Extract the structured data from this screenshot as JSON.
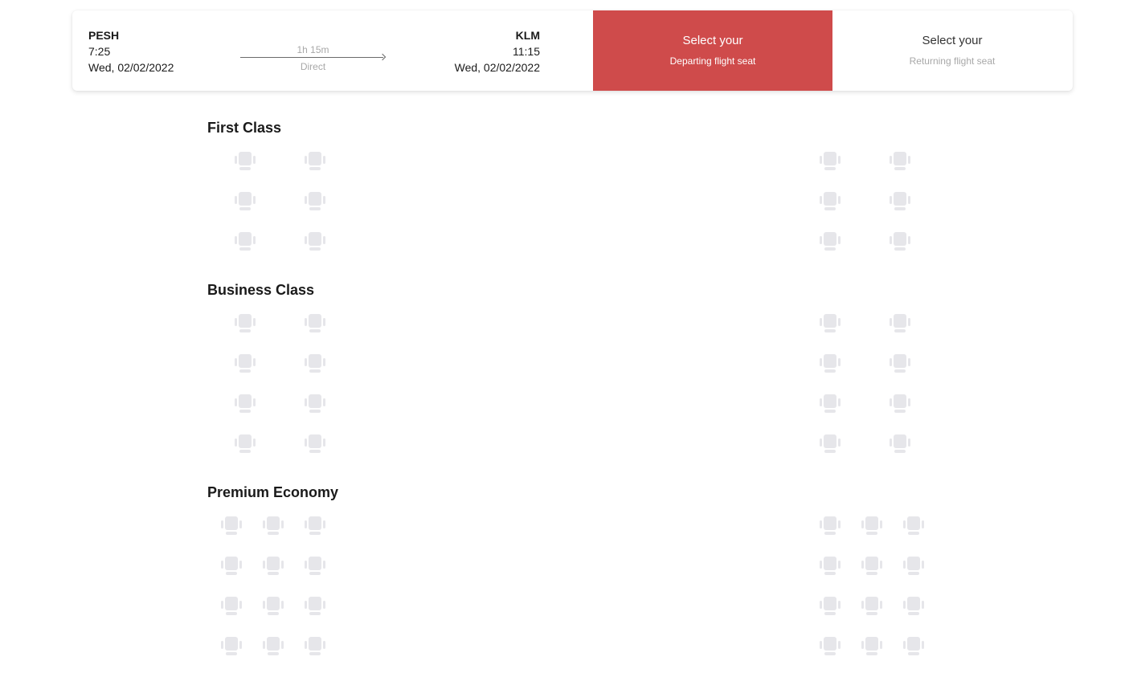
{
  "flight": {
    "departure": {
      "code": "PESH",
      "time": "7:25",
      "date": "Wed, 02/02/2022"
    },
    "arrival": {
      "code": "KLM",
      "time": "11:15",
      "date": "Wed, 02/02/2022"
    },
    "duration": "1h 15m",
    "type": "Direct"
  },
  "tabs": {
    "departing": {
      "line1": "Select your",
      "line2": "Departing flight seat"
    },
    "returning": {
      "line1": "Select your",
      "line2": "Returning flight seat"
    }
  },
  "colors": {
    "accent": "#cf4b4b",
    "seat_available": "#e6e6ea"
  },
  "seat_icon": "seat-icon",
  "sections": [
    {
      "title": "First Class",
      "rows": 3,
      "left_seats_per_row": 2,
      "right_seats_per_row": 2
    },
    {
      "title": "Business Class",
      "rows": 4,
      "left_seats_per_row": 2,
      "right_seats_per_row": 2
    },
    {
      "title": "Premium Economy",
      "rows": 4,
      "left_seats_per_row": 3,
      "right_seats_per_row": 3
    }
  ]
}
